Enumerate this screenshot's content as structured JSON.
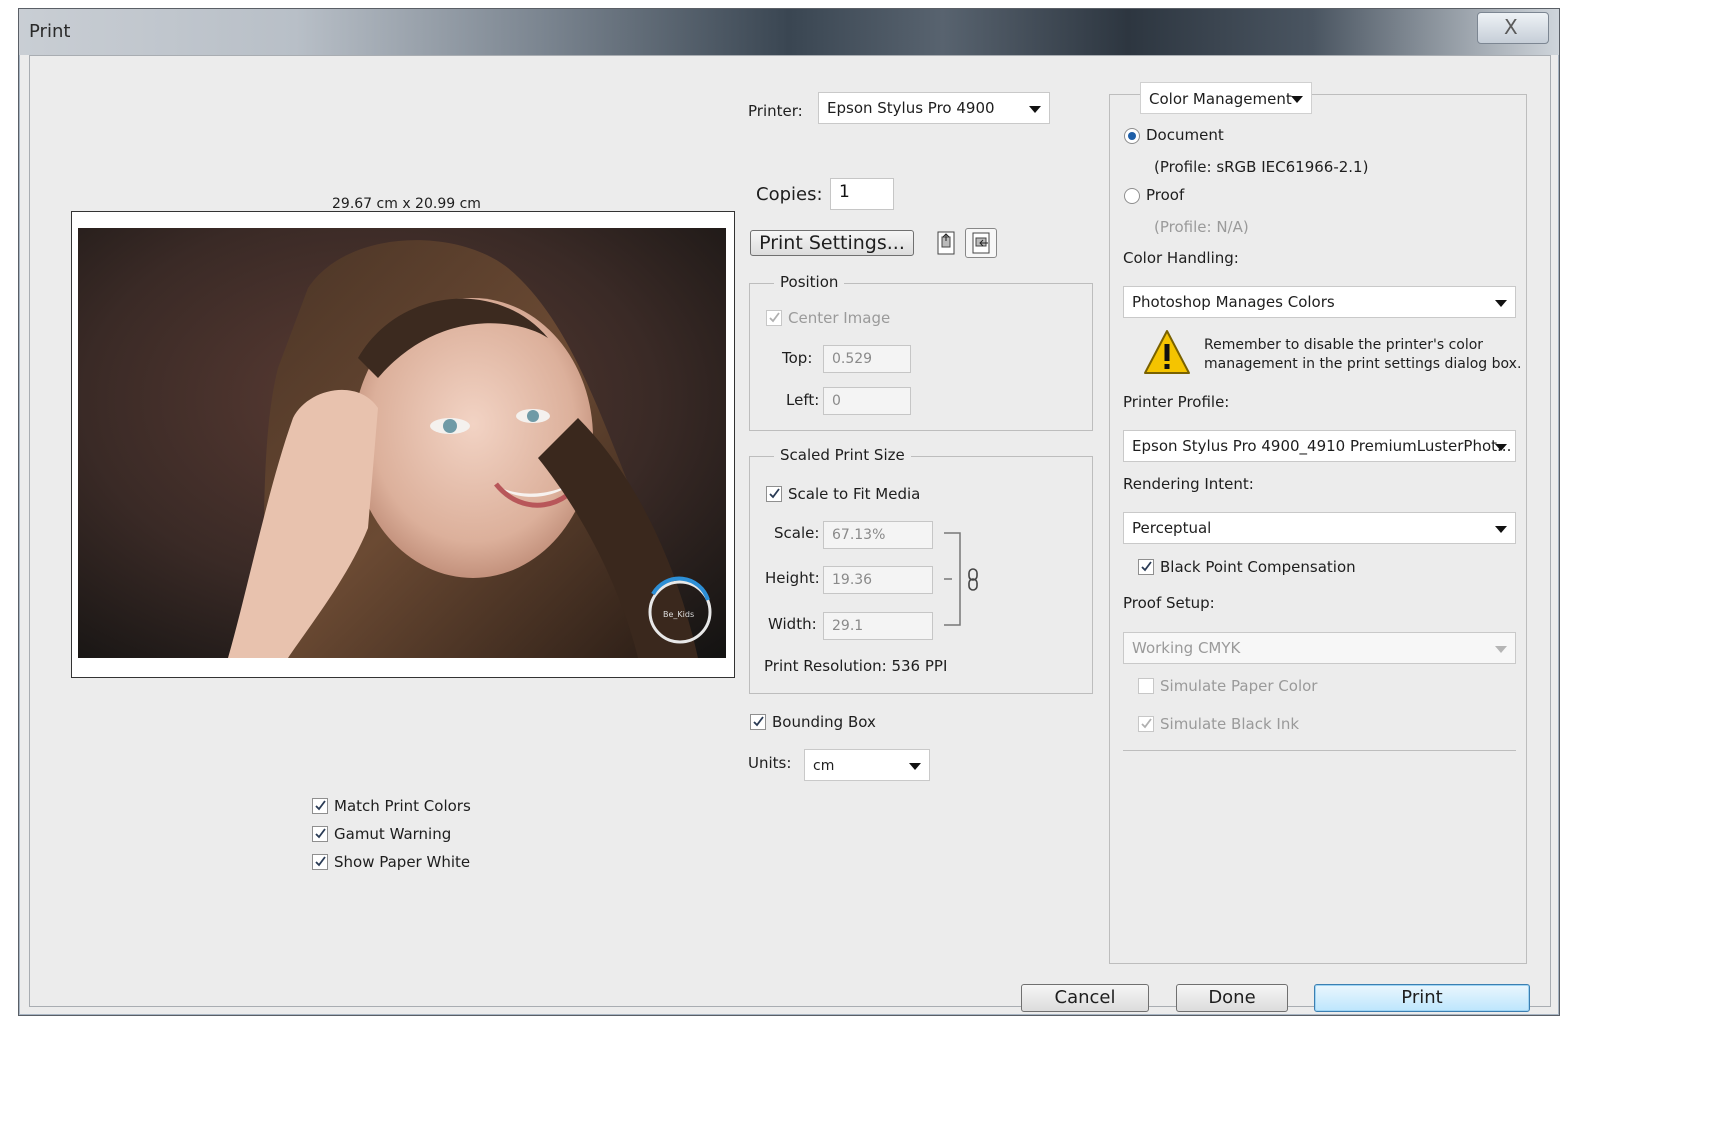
{
  "window": {
    "title": "Print",
    "close_label": "X"
  },
  "preview": {
    "size_label": "29.67 cm x 20.99 cm",
    "watermark_text": "Be_Kids"
  },
  "printer": {
    "label": "Printer:",
    "value": "Epson Stylus Pro 4900"
  },
  "copies": {
    "label": "Copies:",
    "value": "1"
  },
  "print_settings": {
    "label": "Print Settings..."
  },
  "position": {
    "title": "Position",
    "center_image": {
      "label": "Center Image",
      "checked": true,
      "disabled": true
    },
    "top": {
      "label": "Top:",
      "value": "0.529"
    },
    "left": {
      "label": "Left:",
      "value": "0"
    }
  },
  "scaled_print_size": {
    "title": "Scaled Print Size",
    "scale_to_fit": {
      "label": "Scale to Fit Media",
      "checked": true
    },
    "scale": {
      "label": "Scale:",
      "value": "67.13%"
    },
    "height": {
      "label": "Height:",
      "value": "19.36"
    },
    "width": {
      "label": "Width:",
      "value": "29.1"
    },
    "resolution": "Print Resolution: 536 PPI"
  },
  "bounding_box": {
    "label": "Bounding Box",
    "checked": true
  },
  "units": {
    "label": "Units:",
    "value": "cm"
  },
  "bottom_checks": [
    {
      "label": "Match Print Colors",
      "checked": true
    },
    {
      "label": "Gamut Warning",
      "checked": true
    },
    {
      "label": "Show Paper White",
      "checked": true
    }
  ],
  "color_management": {
    "section": "Color Management",
    "document": {
      "label": "Document",
      "profile": "(Profile: sRGB IEC61966-2.1)",
      "selected": true
    },
    "proof": {
      "label": "Proof",
      "profile": "(Profile: N/A)",
      "selected": false
    },
    "color_handling": {
      "label": "Color Handling:",
      "value": "Photoshop Manages Colors"
    },
    "warning": {
      "line1": "Remember to disable the printer's color",
      "line2": "management in the print settings dialog box."
    },
    "printer_profile": {
      "label": "Printer Profile:",
      "value": "Epson Stylus Pro 4900_4910 PremiumLusterPhot..."
    },
    "rendering_intent": {
      "label": "Rendering Intent:",
      "value": "Perceptual"
    },
    "black_point": {
      "label": "Black Point Compensation",
      "checked": true
    },
    "proof_setup": {
      "label": "Proof Setup:",
      "value": "Working CMYK"
    },
    "simulate_paper": {
      "label": "Simulate Paper Color",
      "checked": false
    },
    "simulate_black": {
      "label": "Simulate Black Ink",
      "checked": true
    }
  },
  "buttons": {
    "cancel": "Cancel",
    "done": "Done",
    "print": "Print"
  },
  "colors": {
    "accent": "#1f5fa8",
    "primary_button": "#bde6fd",
    "warning": "#f5c400"
  }
}
